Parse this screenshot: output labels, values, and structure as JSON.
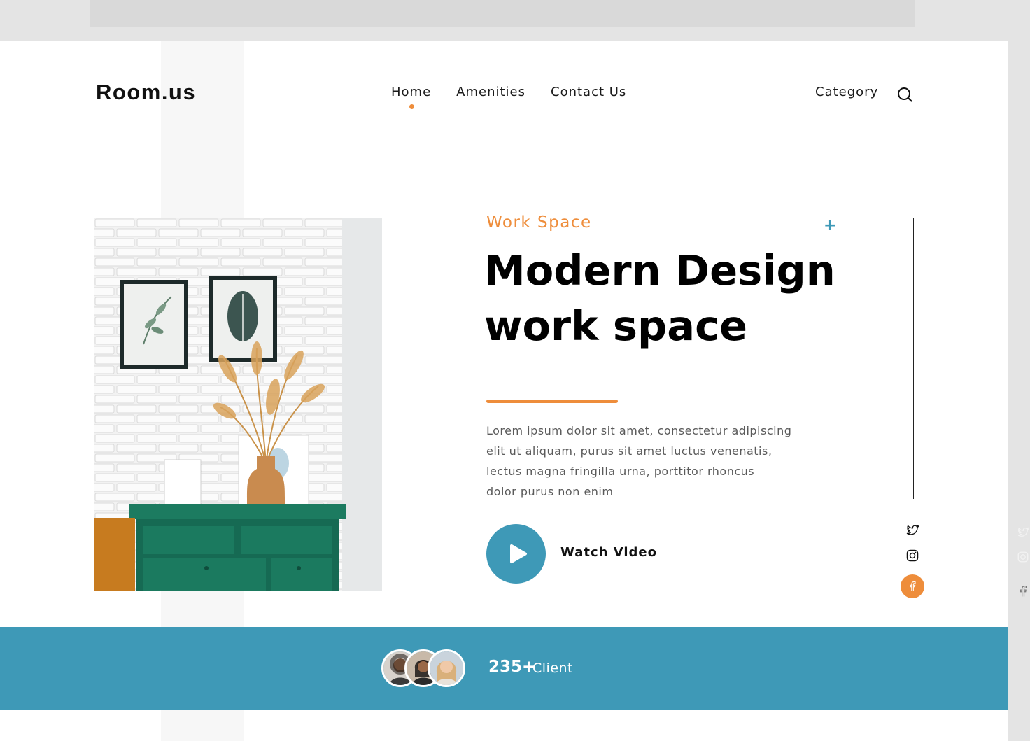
{
  "brand": {
    "logo": "Room.us"
  },
  "nav": {
    "items": [
      {
        "label": "Home",
        "active": true
      },
      {
        "label": "Amenities",
        "active": false
      },
      {
        "label": "Contact Us",
        "active": false
      }
    ],
    "category_label": "Category"
  },
  "hero": {
    "eyebrow": "Work Space",
    "headline_line1": "Modern Design",
    "headline_line2": "work space",
    "body_lines": [
      "Lorem ipsum dolor sit amet, consectetur adipiscing",
      "elit ut aliquam, purus sit amet luctus venenatis,",
      "lectus magna fringilla urna, porttitor rhoncus",
      "dolor purus non enim"
    ],
    "watch_label": "Watch Video"
  },
  "social": [
    "twitter-icon",
    "instagram-icon",
    "facebook-icon"
  ],
  "clients": {
    "count": "235+",
    "label": "Client"
  },
  "colors": {
    "accent": "#ee8d3b",
    "brand_blue": "#3e99b7",
    "text_dark": "#111111",
    "body_text": "#5a5a5a"
  }
}
